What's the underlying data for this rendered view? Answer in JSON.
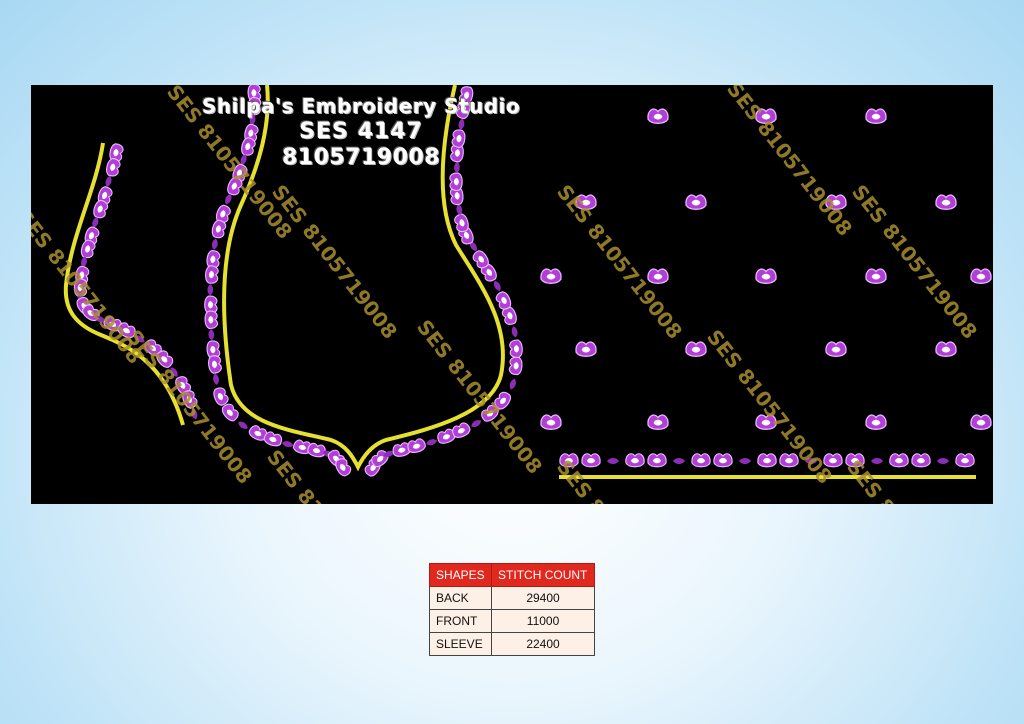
{
  "title": {
    "line1": "Shilpa's Embroidery Studio",
    "line2": "SES 4147",
    "line3": "8105719008"
  },
  "watermark_text": "SES 8105719008",
  "colors": {
    "background": "#000000",
    "outline": "#e6e02e",
    "flower": "#b13fd6",
    "flower_highlight": "#ffffff",
    "watermark": "#a98f2e",
    "table_header": "#e0281e",
    "table_body": "#fdf0e6"
  },
  "table": {
    "headers": [
      "SHAPES",
      "STITCH COUNT"
    ],
    "rows": [
      {
        "shape": "BACK",
        "count": "29400"
      },
      {
        "shape": "FRONT",
        "count": "11000"
      },
      {
        "shape": "SLEEVE",
        "count": "22400"
      }
    ]
  }
}
